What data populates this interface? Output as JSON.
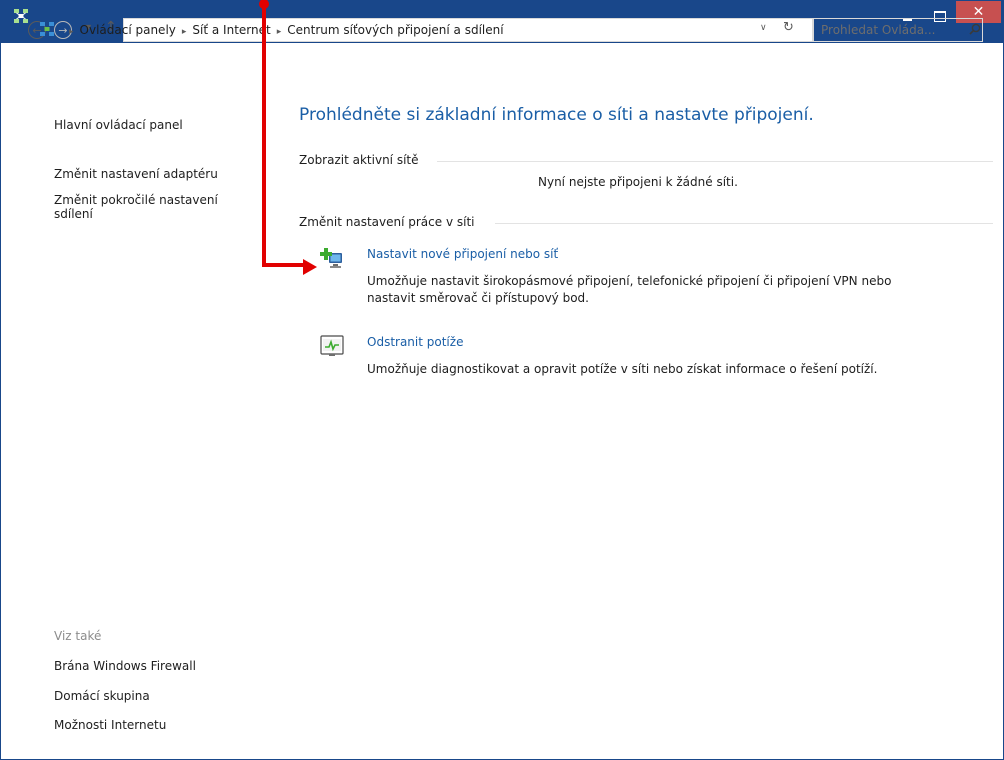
{
  "window": {
    "title": "Centrum síťových připojení a sdílení",
    "close_glyph": "✕"
  },
  "nav": {
    "back_glyph": "←",
    "forward_glyph": "→",
    "recent_glyph": "▼",
    "up_glyph": "↑",
    "crumb_sep": "▸",
    "breadcrumbs": [
      "Ovládací panely",
      "Síť a Internet",
      "Centrum síťových připojení a sdílení"
    ],
    "dropdown_glyph": "∨",
    "refresh_glyph": "↻",
    "search_placeholder": "Prohledat Ovláda..."
  },
  "sidebar": {
    "home": "Hlavní ovládací panel",
    "adapter_settings": "Změnit nastavení adaptéru",
    "advanced_sharing_line1": "Změnit pokročilé nastavení",
    "advanced_sharing_line2": "sdílení",
    "see_also": "Viz také",
    "links": [
      "Brána Windows Firewall",
      "Domácí skupina",
      "Možnosti Internetu"
    ]
  },
  "main": {
    "heading": "Prohlédněte si základní informace o síti a nastavte připojení.",
    "active_networks_label": "Zobrazit aktivní sítě",
    "no_network": "Nyní nejste připojeni k žádné síti.",
    "change_settings_label": "Změnit nastavení práce v síti",
    "tasks": [
      {
        "title": "Nastavit nové připojení nebo síť",
        "desc_line1": "Umožňuje nastavit širokopásmové připojení, telefonické připojení či připojení VPN nebo",
        "desc_line2": "nastavit směrovač či přístupový bod."
      },
      {
        "title": "Odstranit potíže",
        "desc_line1": "Umožňuje diagnostikovat a opravit potíže v síti nebo získat informace o řešení potíží."
      }
    ]
  },
  "colors": {
    "titlebar": "#19478a",
    "link": "#1a5ea6",
    "annotation": "#e10000",
    "close_button": "#c75050"
  },
  "icons": {
    "app": "network-center-icon",
    "new_connection": "new-connection-icon",
    "troubleshoot": "troubleshoot-icon",
    "search": "search-icon"
  }
}
